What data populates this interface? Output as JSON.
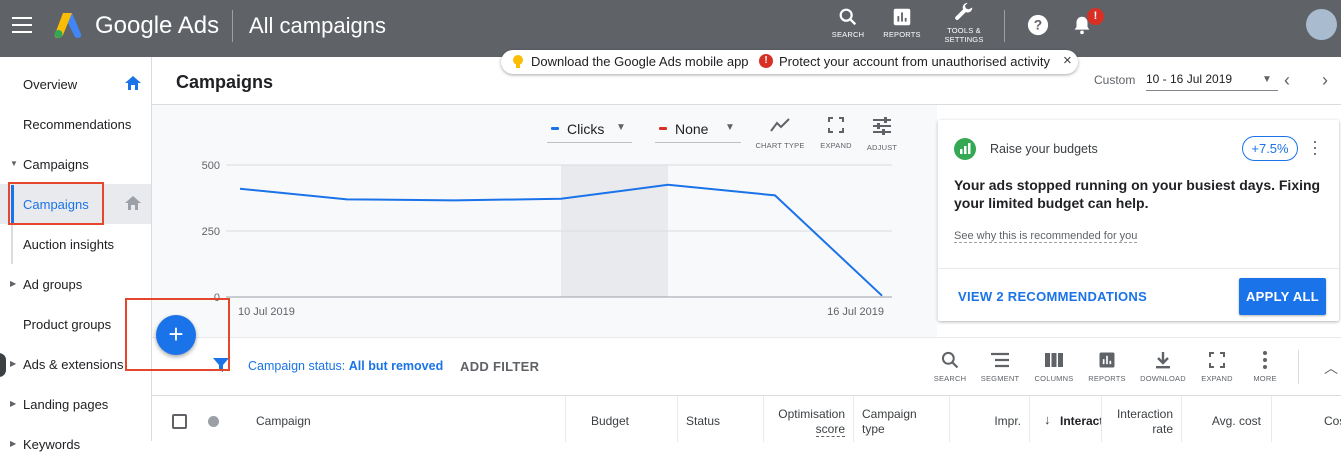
{
  "app": {
    "brand": "Google Ads",
    "page_title": "All campaigns"
  },
  "top_tools": [
    {
      "label": "SEARCH",
      "icon": "search-icon"
    },
    {
      "label": "REPORTS",
      "icon": "reports-icon"
    },
    {
      "label": "TOOLS &\nSETTINGS",
      "label1": "TOOLS &",
      "label2": "SETTINGS",
      "icon": "wrench-icon"
    }
  ],
  "help_icon": "help-icon",
  "notifications": {
    "icon": "bell-icon",
    "badge": "!"
  },
  "banner": {
    "app_msg": "Download the Google Ads mobile app",
    "security_msg": "Protect your account from unauthorised activity",
    "close": "×"
  },
  "sidebar": {
    "items": [
      {
        "label": "Overview"
      },
      {
        "label": "Recommendations"
      },
      {
        "label": "Campaigns",
        "expanded": true
      },
      {
        "label": "Campaigns",
        "active": true
      },
      {
        "label": "Auction insights"
      },
      {
        "label": "Ad groups"
      },
      {
        "label": "Product groups"
      },
      {
        "label": "Ads & extensions"
      },
      {
        "label": "Landing pages"
      },
      {
        "label": "Keywords"
      }
    ]
  },
  "header": {
    "title": "Campaigns",
    "date_label": "Custom",
    "date_range": "10 - 16 Jul 2019"
  },
  "chart_controls": {
    "metric1": "Clicks",
    "metric2": "None",
    "tools": [
      "CHART TYPE",
      "EXPAND",
      "ADJUST"
    ]
  },
  "chart_data": {
    "type": "line",
    "x": [
      "10 Jul 2019",
      "11 Jul 2019",
      "12 Jul 2019",
      "13 Jul 2019",
      "14 Jul 2019",
      "15 Jul 2019",
      "16 Jul 2019"
    ],
    "x_tick_labels": [
      "10 Jul 2019",
      "16 Jul 2019"
    ],
    "series": [
      {
        "values": [
          410,
          370,
          366,
          372,
          425,
          385,
          5
        ],
        "color": "#1a73e8"
      }
    ],
    "y_ticks": [
      0,
      250,
      500
    ],
    "ylim": [
      0,
      500
    ],
    "highlight_range": [
      "13 Jul 2019",
      "14 Jul 2019"
    ],
    "grid": true
  },
  "recommendation": {
    "title": "Raise your budgets",
    "uplift": "+7.5%",
    "body": "Your ads stopped running on your busiest days. Fixing your limited budget can help.",
    "link": "See why this is recommended for you",
    "view_label": "VIEW 2 RECOMMENDATIONS",
    "apply_label": "APPLY ALL"
  },
  "fab": {
    "label": "+"
  },
  "filter": {
    "status_label": "Campaign status:",
    "status_value": "All but removed",
    "add_filter": "ADD FILTER"
  },
  "table_tools": [
    {
      "label": "SEARCH",
      "icon": "search-icon"
    },
    {
      "label": "SEGMENT",
      "icon": "segment-icon"
    },
    {
      "label": "COLUMNS",
      "icon": "columns-icon"
    },
    {
      "label": "REPORTS",
      "icon": "reports-icon"
    },
    {
      "label": "DOWNLOAD",
      "icon": "download-icon"
    },
    {
      "label": "EXPAND",
      "icon": "expand-icon"
    },
    {
      "label": "MORE",
      "icon": "more-vert-icon"
    }
  ],
  "table": {
    "columns": [
      "Campaign",
      "Budget",
      "Status",
      "Optimisation score",
      "Campaign type",
      "Impr.",
      "Interact",
      "Interaction rate",
      "Avg. cost",
      "Cos"
    ],
    "opt1": "Optimisation",
    "opt2": "score",
    "ct1": "Campaign",
    "ct2": "type",
    "ir1": "Interaction",
    "ir2": "rate"
  }
}
